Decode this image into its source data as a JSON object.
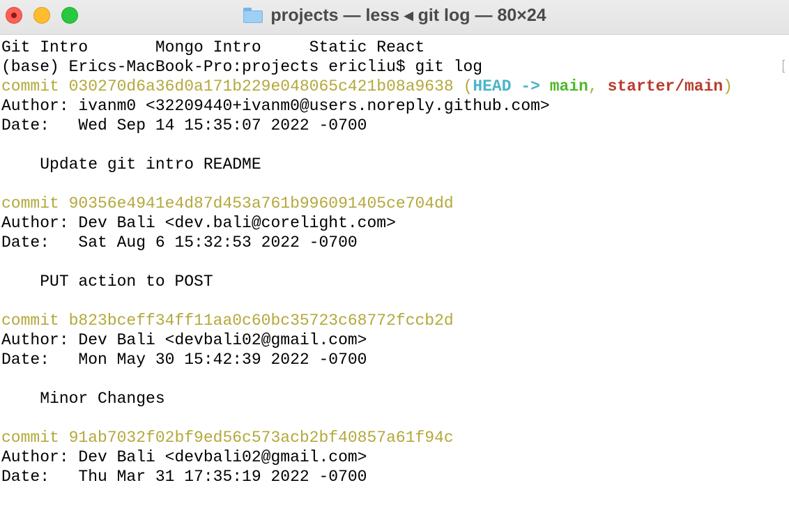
{
  "window": {
    "title": "projects — less ◂ git log — 80×24",
    "icon": "folder-icon"
  },
  "terminal": {
    "top_line": "Git Intro       Mongo Intro     Static React",
    "prompt_line": "(base) Erics-MacBook-Pro:projects ericliu$ git log",
    "commits": [
      {
        "commit_line": "commit 030270d6a36d0a171b229e048065c421b08a9638",
        "refs": {
          "open": " (",
          "head": "HEAD -> ",
          "branch": "main",
          "sep": ", ",
          "remote": "starter/main",
          "close": ")"
        },
        "author_line": "Author: ivanm0 <32209440+ivanm0@users.noreply.github.com>",
        "date_line": "Date:   Wed Sep 14 15:35:07 2022 -0700",
        "message": "    Update git intro README"
      },
      {
        "commit_line": "commit 90356e4941e4d87d453a761b996091405ce704dd",
        "author_line": "Author: Dev Bali <dev.bali@corelight.com>",
        "date_line": "Date:   Sat Aug 6 15:32:53 2022 -0700",
        "message": "    PUT action to POST"
      },
      {
        "commit_line": "commit b823bceff34ff11aa0c60bc35723c68772fccb2d",
        "author_line": "Author: Dev Bali <devbali02@gmail.com>",
        "date_line": "Date:   Mon May 30 15:42:39 2022 -0700",
        "message": "    Minor Changes"
      },
      {
        "commit_line": "commit 91ab7032f02bf9ed56c573acb2bf40857a61f94c",
        "author_line": "Author: Dev Bali <devbali02@gmail.com>",
        "date_line": "Date:   Thu Mar 31 17:35:19 2022 -0700"
      }
    ]
  },
  "colors": {
    "commit_hash": "#b3a93c",
    "head_ref": "#4bb4c8",
    "branch_ref": "#4fb82a",
    "remote_ref": "#b83b2b"
  }
}
